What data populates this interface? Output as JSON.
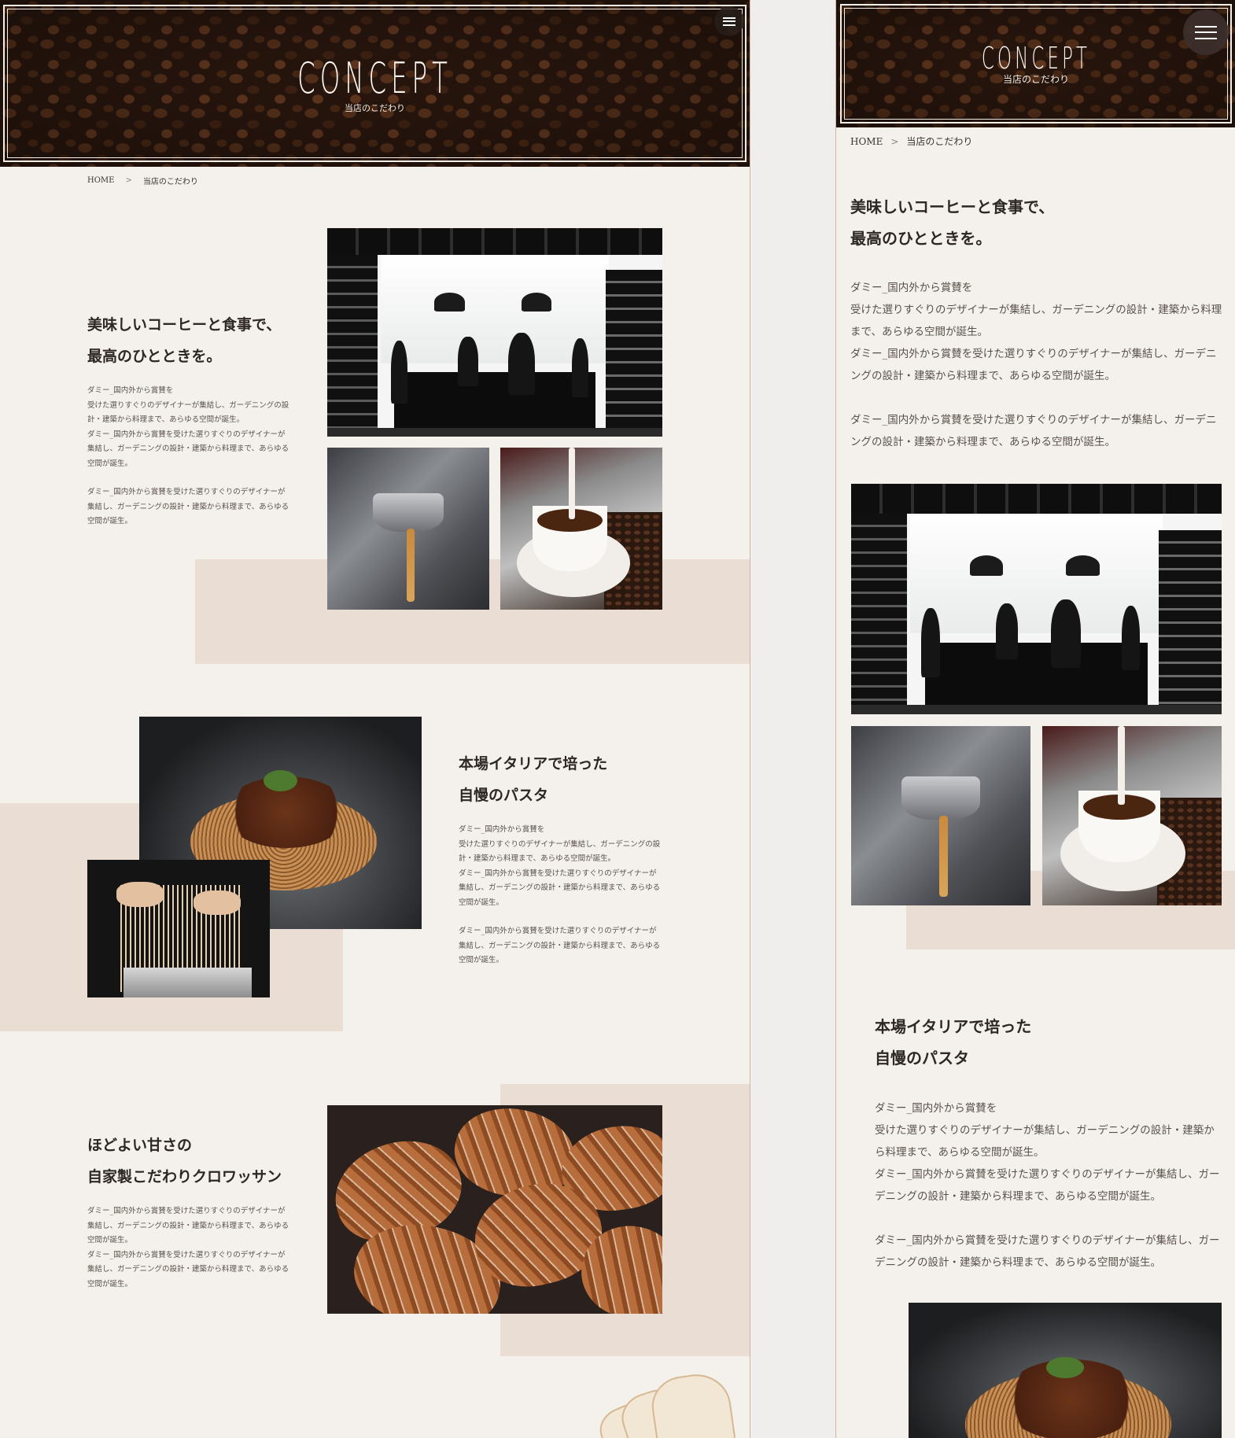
{
  "hero": {
    "title": "CONCEPT",
    "subtitle": "当店のこだわり",
    "menu_icon": "hamburger-menu-icon"
  },
  "breadcrumb": {
    "home": "HOME",
    "separator": ">",
    "current": "当店のこだわり"
  },
  "sections": [
    {
      "heading_line1": "美味しいコーヒーと食事で、",
      "heading_line2": "最高のひとときを。",
      "p1": "ダミー_国内外から賞賛を",
      "p2": "受けた選りすぐりのデザイナーが集結し、ガーデニングの設計・建築から料理まで、あらゆる空間が誕生。",
      "p3": "ダミー_国内外から賞賛を受けた選りすぐりのデザイナーが集結し、ガーデニングの設計・建築から料理まで、あらゆる空間が誕生。",
      "p4": "ダミー_国内外から賞賛を受けた選りすぐりのデザイナーが集結し、ガーデニングの設計・建築から料理まで、あらゆる空間が誕生。"
    },
    {
      "heading_line1": "本場イタリアで培った",
      "heading_line2": "自慢のパスタ",
      "p1": "ダミー_国内外から賞賛を",
      "p2": "受けた選りすぐりのデザイナーが集結し、ガーデニングの設計・建築から料理まで、あらゆる空間が誕生。",
      "p3": "ダミー_国内外から賞賛を受けた選りすぐりのデザイナーが集結し、ガーデニングの設計・建築から料理まで、あらゆる空間が誕生。",
      "p4": "ダミー_国内外から賞賛を受けた選りすぐりのデザイナーが集結し、ガーデニングの設計・建築から料理まで、あらゆる空間が誕生。"
    },
    {
      "heading_line1": "ほどよい甘さの",
      "heading_line2": "自家製こだわりクロワッサン",
      "p1": "ダミー_国内外から賞賛を受けた選りすぐりのデザイナーが集結し、ガーデニングの設計・建築から料理まで、あらゆる空間が誕生。",
      "p2": "ダミー_国内外から賞賛を受けた選りすぐりのデザイナーが集結し、ガーデニングの設計・建築から料理まで、あらゆる空間が誕生。"
    }
  ],
  "colors": {
    "page_background": "#f4f1ec",
    "accent_block": "#e9ddd4",
    "text": "#2b2522"
  }
}
